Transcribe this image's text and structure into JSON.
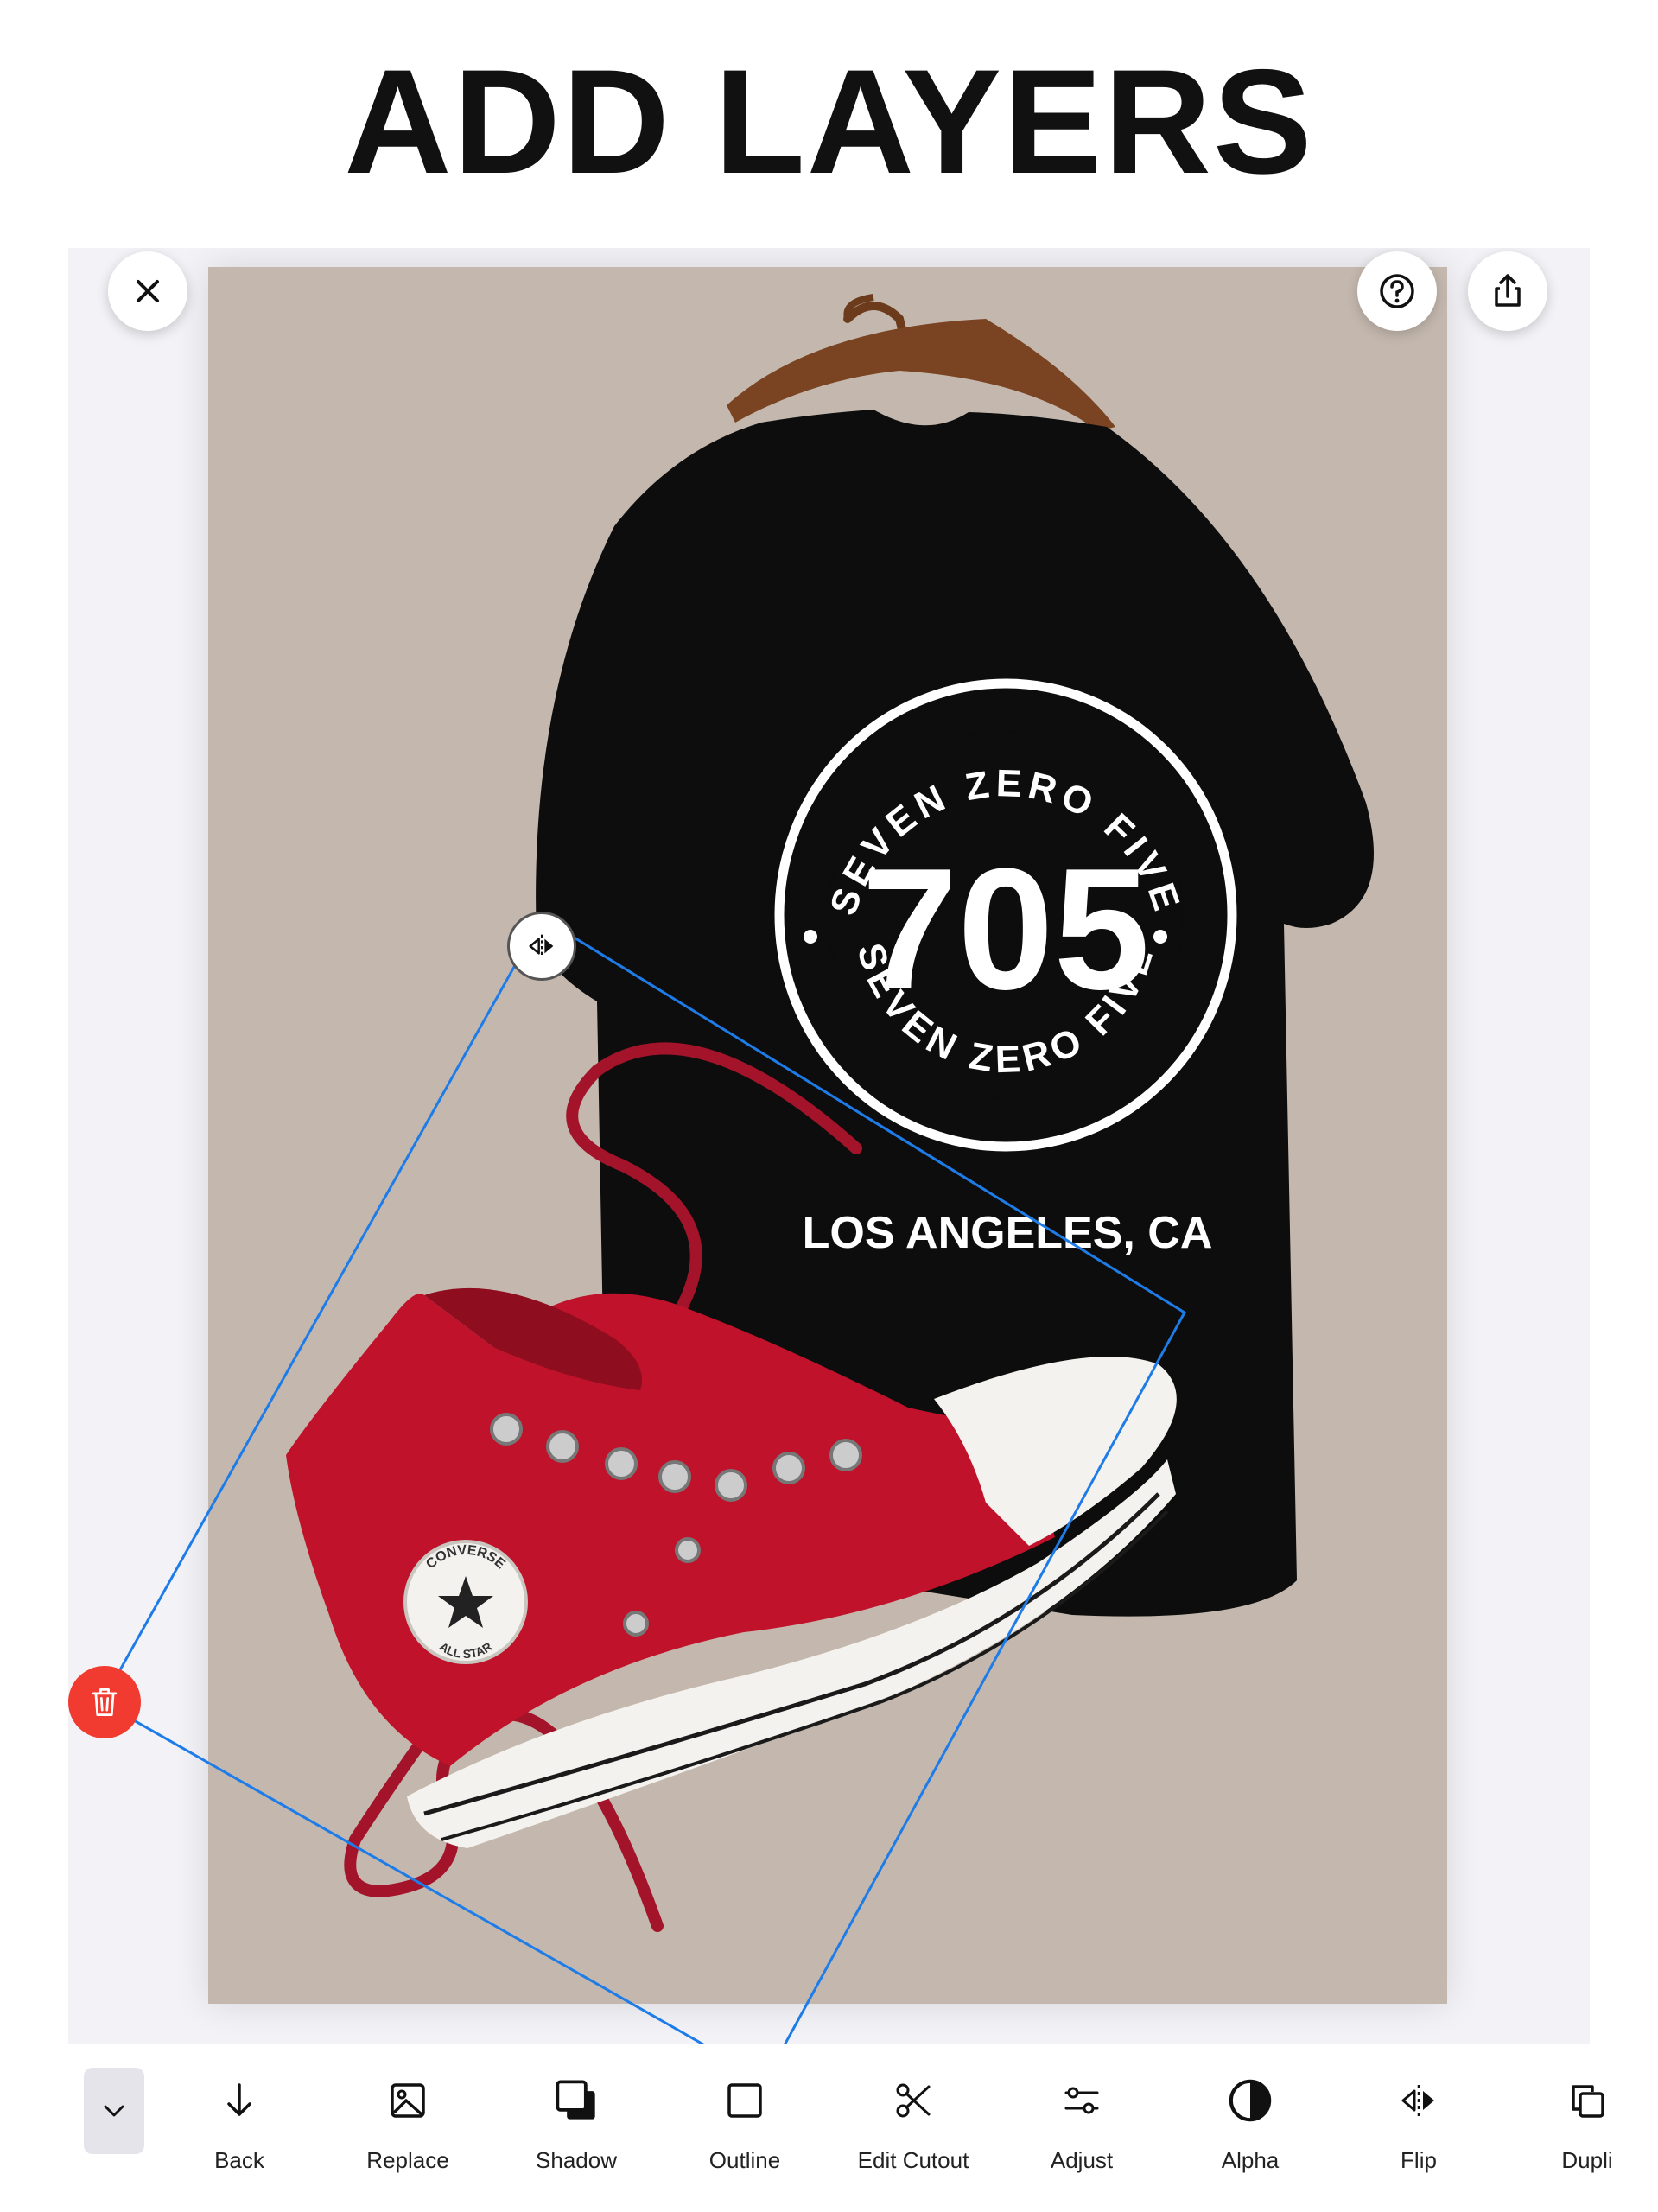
{
  "headline": "ADD LAYERS",
  "editor": {
    "close_icon": "close-icon",
    "help_icon": "question-circle-icon",
    "share_icon": "share-icon",
    "flip_handle_icon": "flip-horizontal-icon",
    "delete_handle_icon": "trash-icon",
    "selection_color": "#1e7ce8",
    "canvas_background": "#c4b8ae"
  },
  "tshirt_print": {
    "top_arc": "SEVEN ZERO FIVE",
    "number": "705",
    "bottom_arc": "SEVEN ZERO FIVE",
    "city": "LOS ANGELES, CA"
  },
  "shoe_patch": {
    "top": "CONVERSE",
    "bottom": "ALL STAR"
  },
  "toolbar": {
    "collapse_icon": "chevron-down-icon",
    "items": [
      {
        "label": "Back",
        "icon": "arrow-down-icon"
      },
      {
        "label": "Replace",
        "icon": "image-icon"
      },
      {
        "label": "Shadow",
        "icon": "shadow-square-icon"
      },
      {
        "label": "Outline",
        "icon": "square-outline-icon"
      },
      {
        "label": "Edit Cutout",
        "icon": "scissors-icon"
      },
      {
        "label": "Adjust",
        "icon": "sliders-icon"
      },
      {
        "label": "Alpha",
        "icon": "half-circle-icon"
      },
      {
        "label": "Flip",
        "icon": "flip-horizontal-icon"
      },
      {
        "label": "Dupli",
        "icon": "duplicate-icon"
      }
    ]
  }
}
